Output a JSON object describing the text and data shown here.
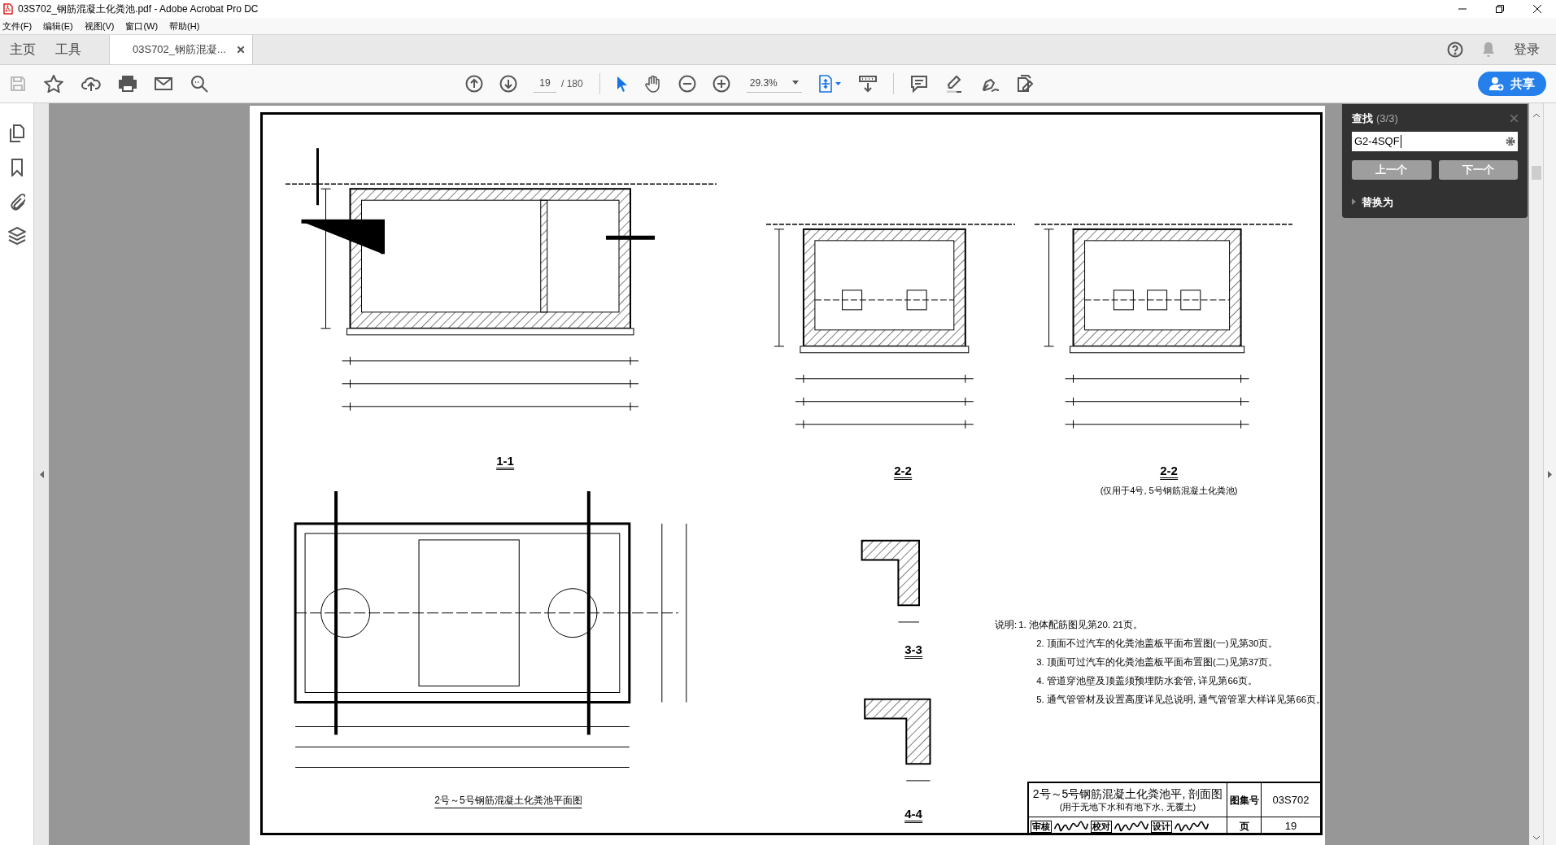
{
  "window": {
    "title": "03S702_钢筋混凝土化粪池.pdf - Adobe Acrobat Pro DC"
  },
  "menu": [
    "文件(F)",
    "编辑(E)",
    "视图(V)",
    "窗口(W)",
    "帮助(H)"
  ],
  "top_tabs": [
    {
      "label": "主页",
      "kind": "home",
      "selected": false
    },
    {
      "label": "工具",
      "kind": "home",
      "selected": false
    },
    {
      "label": "03S702_钢筋混凝...",
      "kind": "document",
      "selected": true
    }
  ],
  "account": {
    "sign_in": "登录"
  },
  "toolbar": {
    "page": "19",
    "page_total": "/ 180",
    "zoom": "29.3%",
    "share": "共享"
  },
  "find_panel": {
    "title": "查找",
    "count": "(3/3)",
    "query": "G2-4SQF",
    "prev": "上一个",
    "next": "下一个",
    "replace": {
      "label": "替换为",
      "expanded": false
    }
  },
  "document": {
    "views": [
      {
        "kind": "section",
        "label": "1-1"
      },
      {
        "kind": "cross",
        "label": "2-2"
      },
      {
        "kind": "cross3",
        "label": "2-2",
        "note": "(仅用于4号, 5号钢筋混凝土化粪池)"
      },
      {
        "kind": "plan",
        "label": "2号～5号钢筋混凝土化粪池平面图"
      },
      {
        "kind": "detail",
        "label": "3-3"
      },
      {
        "kind": "detail",
        "label": "4-4"
      }
    ],
    "notes": {
      "heading": "说明:",
      "items": [
        "1. 池体配筋图见第20. 21页。",
        "2. 顶面不过汽车的化粪池盖板平面布置图(一)见第30页。",
        "3. 顶面可过汽车的化粪池盖板平面布置图(二)见第37页。",
        "4. 管道穿池壁及顶盖须预埋防水套管, 详见第66页。",
        "5. 通气管管材及设置高度详见总说明, 通气管管罩大样详见第66页。"
      ]
    },
    "title_block": {
      "title": "2号～5号钢筋混凝土化粪池平, 剖面图",
      "subtitle": "(用于无地下水和有地下水, 无覆土)",
      "drawing_no_label": "图集号",
      "drawing_no": "03S702",
      "page_label": "页",
      "page": "19",
      "signers": [
        "审核",
        "校对",
        "设计"
      ]
    }
  }
}
